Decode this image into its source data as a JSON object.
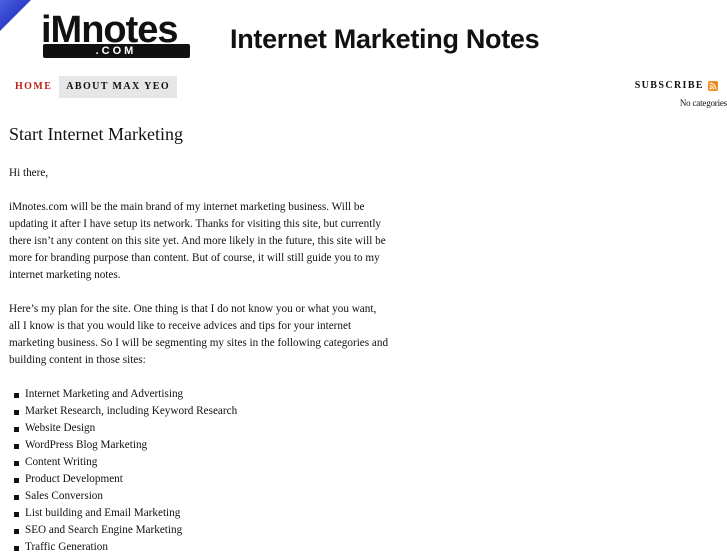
{
  "logo": {
    "main": "iMnotes",
    "sub": ".COM"
  },
  "site_title": "Internet Marketing Notes",
  "nav": {
    "home": "HOME",
    "about": "ABOUT MAX YEO"
  },
  "subscribe": {
    "label": "SUBSCRIBE",
    "categories_empty": "No categories"
  },
  "post": {
    "title": "Start Internet Marketing",
    "paragraphs": [
      "Hi there,",
      "iMnotes.com will be the main brand of my internet marketing business. Will be updating it after I have setup its network. Thanks for visiting this site, but currently there isn’t any content on this site yet. And more likely in the future, this site will be more for branding purpose than content. But of course, it will still guide you to my internet marketing notes.",
      "Here’s my plan for the site. One thing is that I do not know you or what you want, all I know is that you would like to receive advices and tips for your internet marketing business. So I will be segmenting my sites in the following categories and building content in those sites:"
    ],
    "list": [
      "Internet Marketing and Advertising",
      "Market Research, including Keyword Research",
      "Website Design",
      "WordPress Blog Marketing",
      "Content Writing",
      "Product Development",
      "Sales Conversion",
      "List building and Email Marketing",
      "SEO and Search Engine Marketing",
      "Traffic Generation"
    ]
  },
  "colors": {
    "accent": "#c0201c",
    "nav_active_bg": "#e6e6e6",
    "rss": "#f08a1c",
    "corner": "#2d3fc9"
  },
  "icons": {
    "rss": "rss-icon"
  }
}
